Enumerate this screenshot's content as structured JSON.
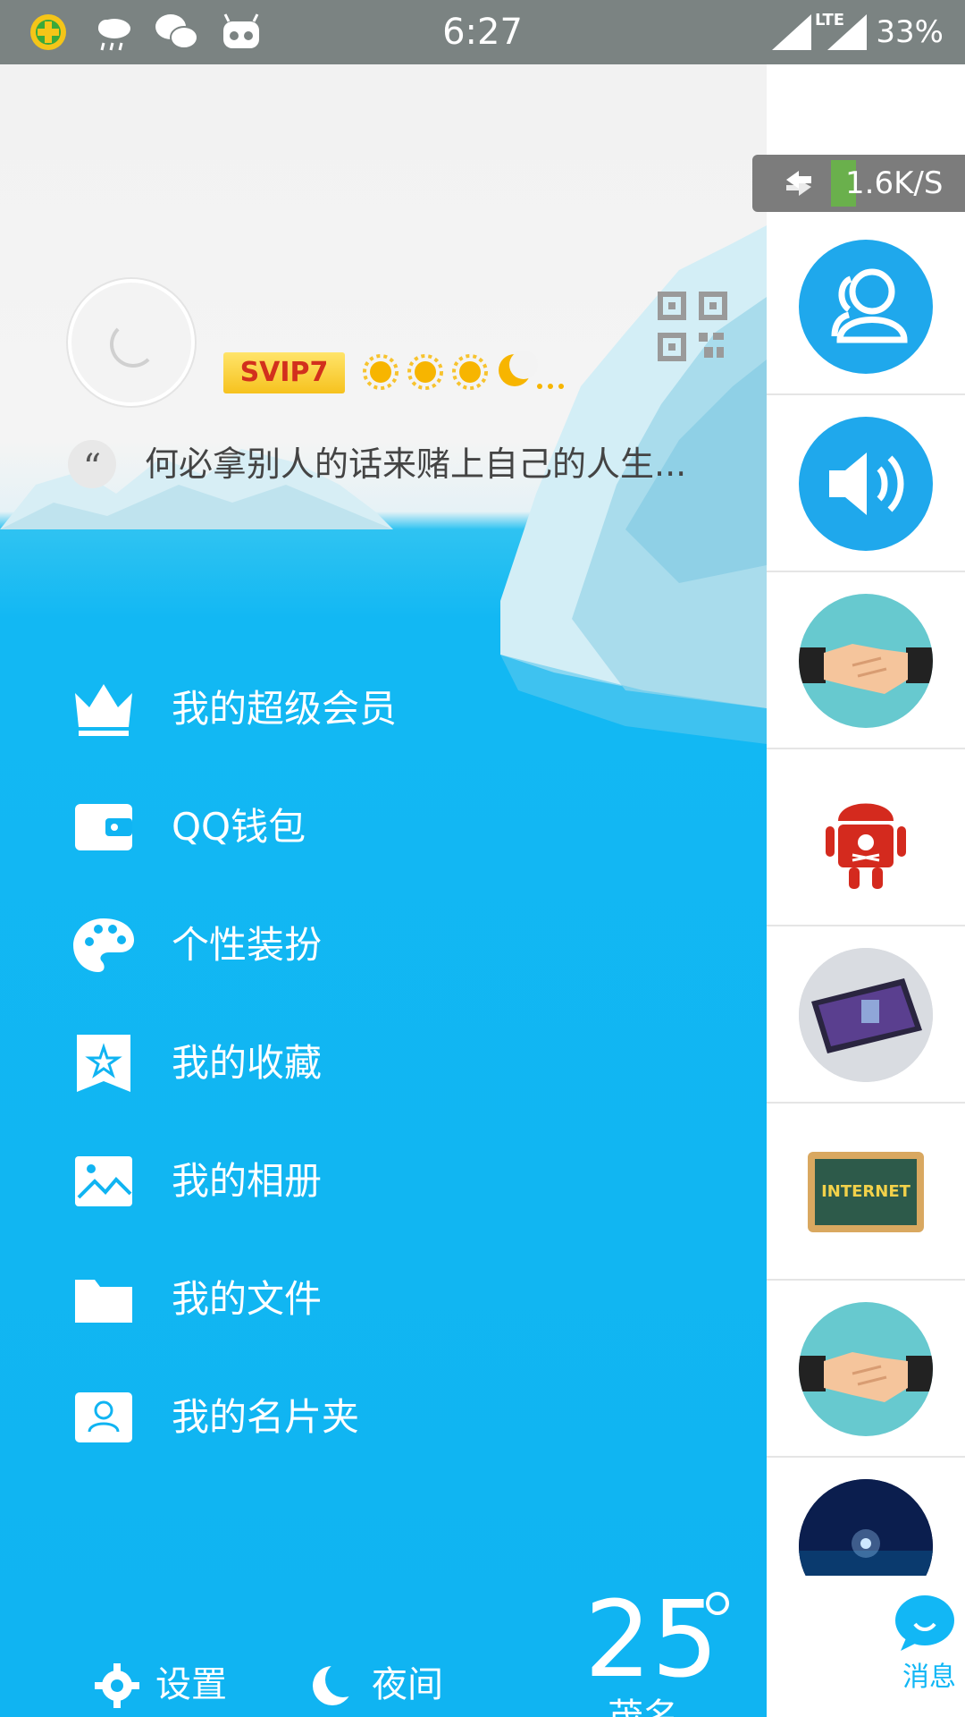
{
  "status_bar": {
    "time": "6:27",
    "network": "LTE",
    "battery": "33%",
    "icons": [
      "360-security-icon",
      "rain-weather-icon",
      "wechat-icon",
      "cyanogen-icon",
      "signal-icon",
      "lte-signal-icon"
    ]
  },
  "profile": {
    "vip_badge": "SVIP7",
    "level_icons": [
      "sun-icon",
      "sun-icon",
      "sun-icon",
      "moon-icon"
    ],
    "level_more": "...",
    "signature": "何必拿别人的话来赌上自己的人生..."
  },
  "menu": [
    {
      "icon": "crown-icon",
      "label": "我的超级会员"
    },
    {
      "icon": "wallet-icon",
      "label": "QQ钱包"
    },
    {
      "icon": "palette-icon",
      "label": "个性装扮"
    },
    {
      "icon": "bookmark-star-icon",
      "label": "我的收藏"
    },
    {
      "icon": "image-icon",
      "label": "我的相册"
    },
    {
      "icon": "folder-icon",
      "label": "我的文件"
    },
    {
      "icon": "contact-card-icon",
      "label": "我的名片夹"
    }
  ],
  "bottom": {
    "settings_label": "设置",
    "night_label": "夜间"
  },
  "weather": {
    "temperature": "25",
    "city": "茂名"
  },
  "network_speed": "1.6K/S",
  "conversations": [
    {
      "avatar": "contacts-avatar"
    },
    {
      "avatar": "speaker-avatar"
    },
    {
      "avatar": "handshake-avatar"
    },
    {
      "avatar": "pirate-android-avatar"
    },
    {
      "avatar": "phone-photo-avatar"
    },
    {
      "avatar": "internet-board-avatar"
    },
    {
      "avatar": "handshake-avatar"
    },
    {
      "avatar": "night-sky-avatar"
    }
  ],
  "message_tab": {
    "label": "消息"
  },
  "colors": {
    "accent": "#12b7f5",
    "drawer_blue": "#10b4f2",
    "status_bar": "#7b8382"
  }
}
